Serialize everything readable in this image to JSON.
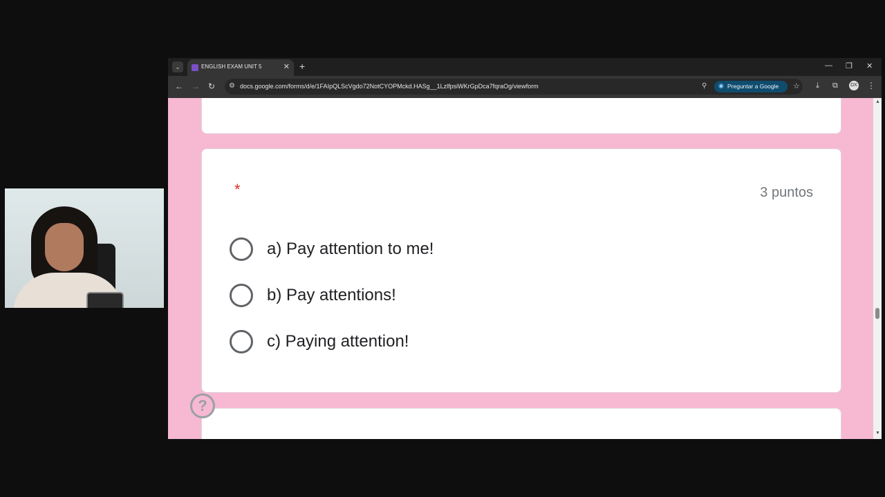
{
  "browser": {
    "tab_title": "ENGLISH EXAM UNIT 5",
    "url": "docs.google.com/forms/d/e/1FAIpQLScVgdo72NotCYOPMckd.HASg__1LzlfpsiWKrGpDca7fqraOg/viewform",
    "ask_google_label": "Preguntar a Google",
    "profile_initials": "DX",
    "icons": {
      "tab_list": "chevron-down-icon",
      "favicon": "google-forms-icon",
      "tab_close": "close-icon",
      "new_tab": "plus-icon",
      "back": "arrow-left-icon",
      "forward": "arrow-right-icon",
      "reload": "reload-icon",
      "site_info": "tune-icon",
      "zoom": "zoom-icon",
      "ask": "google-lens-icon",
      "star": "star-icon",
      "download": "download-icon",
      "extensions": "extensions-icon",
      "menu": "kebab-menu-icon",
      "minimize": "minimize-icon",
      "maximize": "restore-icon",
      "close": "close-icon"
    }
  },
  "form": {
    "background_color": "#f7b8d2",
    "question": {
      "required_marker": "*",
      "points": "3 puntos",
      "options": [
        {
          "label": "a) Pay attention to me!"
        },
        {
          "label": "b) Pay attentions!"
        },
        {
          "label": "c) Paying attention!"
        }
      ]
    },
    "help_icon": "question-mark-icon"
  }
}
